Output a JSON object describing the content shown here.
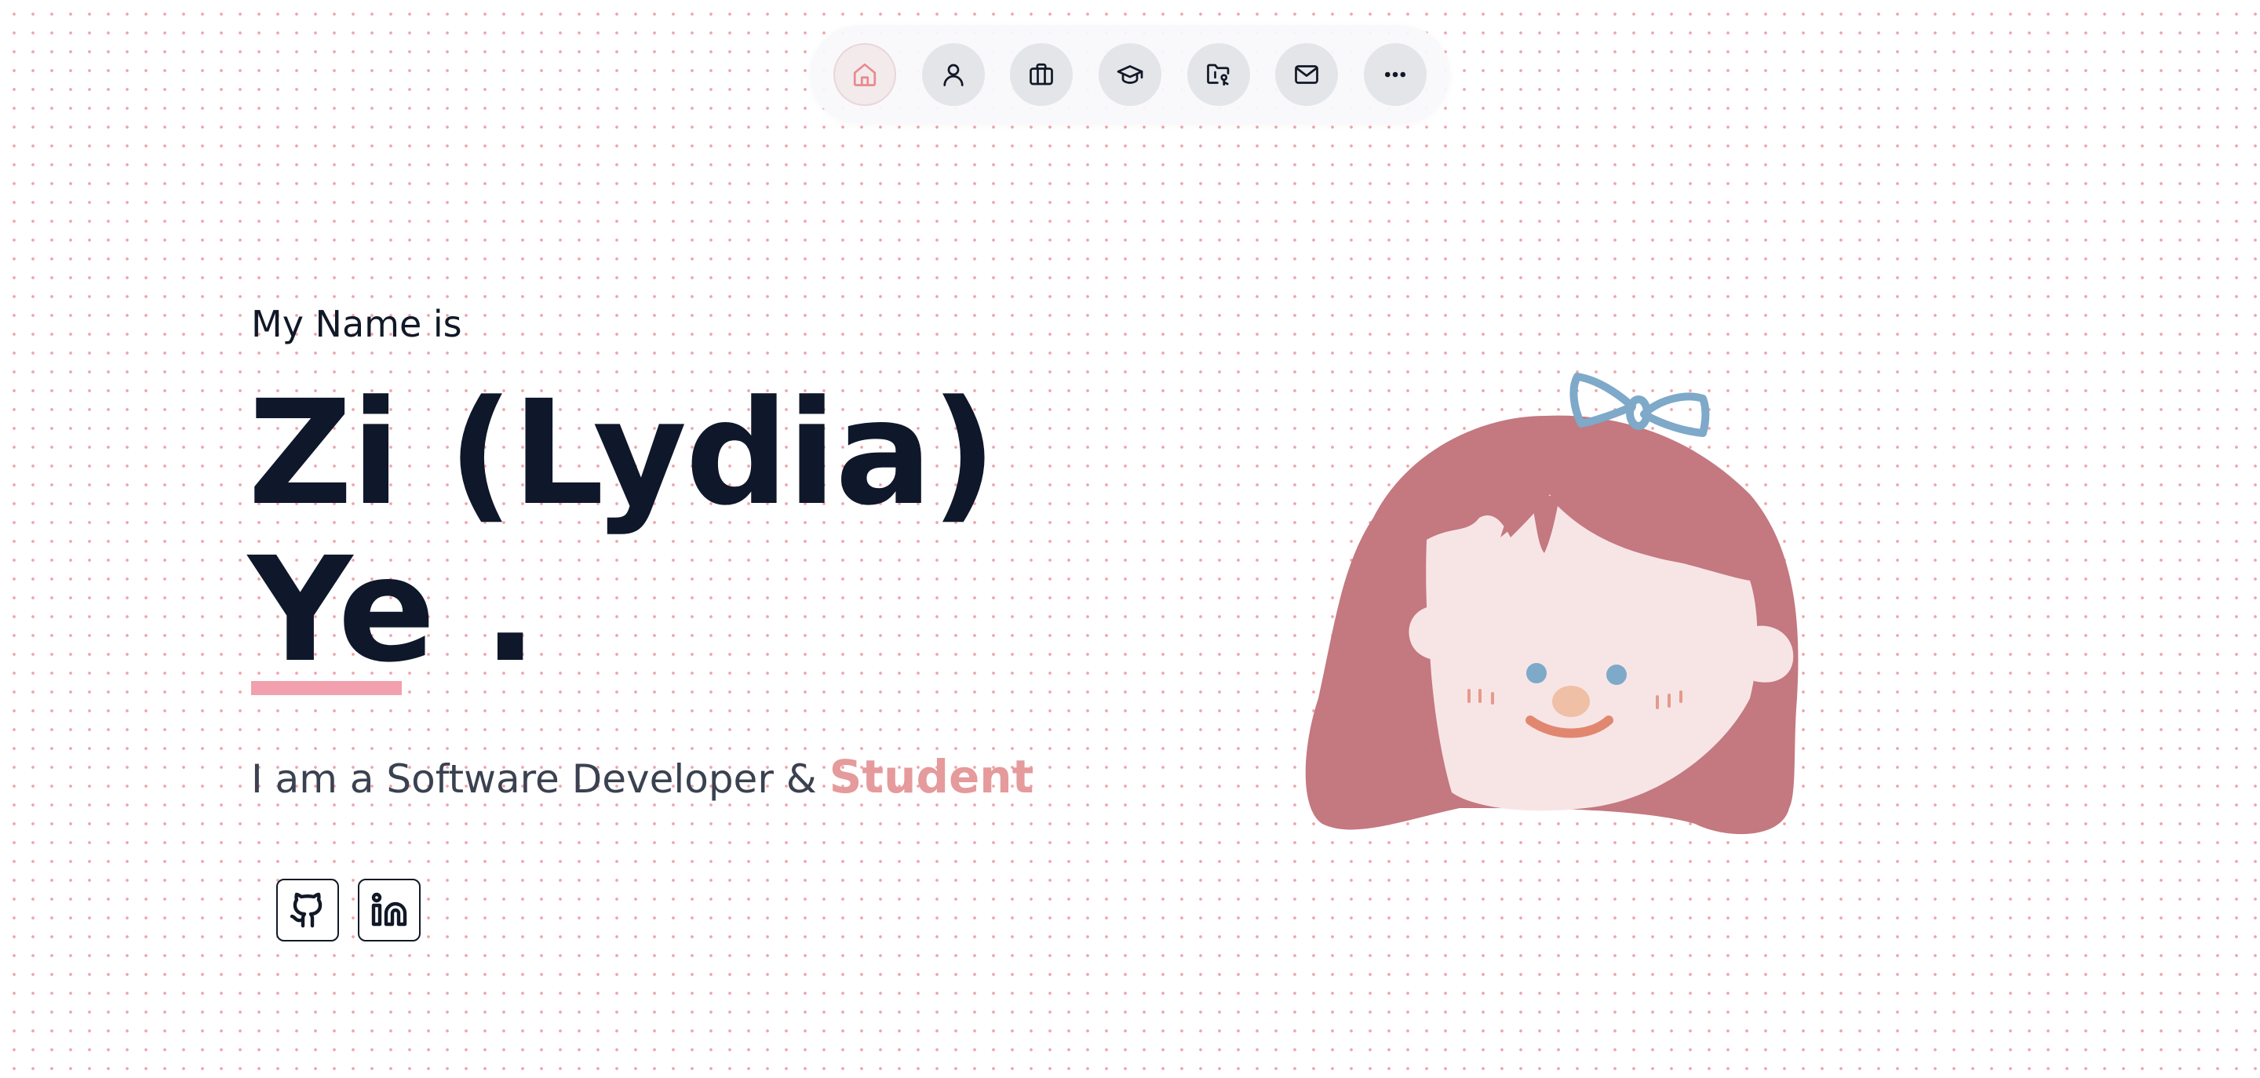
{
  "nav": {
    "items": [
      {
        "icon": "home-icon",
        "active": true
      },
      {
        "icon": "user-icon"
      },
      {
        "icon": "briefcase-icon"
      },
      {
        "icon": "graduation-cap-icon"
      },
      {
        "icon": "folder-code-icon"
      },
      {
        "icon": "mail-icon"
      },
      {
        "icon": "more-icon"
      }
    ]
  },
  "hero": {
    "intro": "My Name is",
    "name_line1": "Zi (Lydia)",
    "name_line2": "Ye .",
    "tagline_prefix": "I am a Software Developer & ",
    "tagline_role": "Student"
  },
  "social": [
    {
      "icon": "github-icon"
    },
    {
      "icon": "linkedin-icon"
    }
  ],
  "colors": {
    "accent": "#e59a9b",
    "underline": "#f2a0ad",
    "hair": "#c47880",
    "face": "#f7e5e6",
    "bow": "#7ea9c9",
    "dots": "#f2a3a8",
    "text": "#0f172a"
  }
}
